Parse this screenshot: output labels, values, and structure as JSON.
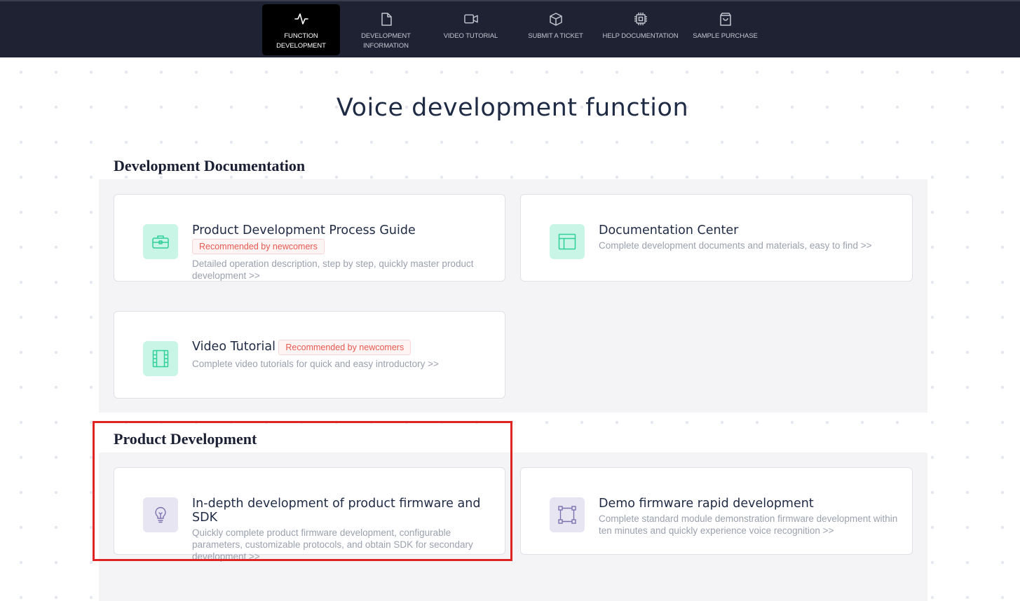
{
  "nav": {
    "items": [
      {
        "label": "FUNCTION DEVELOPMENT",
        "icon": "activity-icon",
        "active": true
      },
      {
        "label": "DEVELOPMENT INFORMATION",
        "icon": "document-icon",
        "active": false
      },
      {
        "label": "VIDEO TUTORIAL",
        "icon": "video-camera-icon",
        "active": false
      },
      {
        "label": "SUBMIT A TICKET",
        "icon": "box-icon",
        "active": false
      },
      {
        "label": "HELP DOCUMENTATION",
        "icon": "chip-icon",
        "active": false
      },
      {
        "label": "SAMPLE PURCHASE",
        "icon": "shopping-bag-icon",
        "active": false
      }
    ]
  },
  "page": {
    "title": "Voice development function"
  },
  "sections": {
    "docs": {
      "heading": "Development Documentation",
      "cards": [
        {
          "title": "Product Development Process Guide",
          "badge": "Recommended by newcomers",
          "desc": "Detailed operation description, step by step, quickly master product development >>",
          "icon": "toolbox-icon"
        },
        {
          "title": "Documentation Center",
          "desc": "Complete development documents and materials, easy to find >>",
          "icon": "layout-icon"
        },
        {
          "title": "Video Tutorial",
          "badge": "Recommended by newcomers",
          "desc": "Complete video tutorials for quick and easy introductory >>",
          "icon": "film-icon"
        }
      ]
    },
    "product": {
      "heading": "Product Development",
      "cards": [
        {
          "title": "In-depth development of product firmware and SDK",
          "desc": "Quickly complete product firmware development, configurable parameters, customizable protocols, and obtain SDK for secondary development >>",
          "icon": "lightbulb-icon"
        },
        {
          "title": "Demo firmware rapid development",
          "desc": "Complete standard module demonstration firmware development within ten minutes and quickly experience voice recognition >>",
          "icon": "frame-icon"
        }
      ]
    }
  },
  "colors": {
    "topbar": "#1f2233",
    "active_nav": "#000000",
    "icon_green": "#2fcf9a",
    "icon_green_bg": "#c8f5e6",
    "icon_purple": "#7d72b0",
    "icon_purple_bg": "#e8e5f3",
    "badge_text": "#e8584f",
    "highlight": "#e02423"
  }
}
